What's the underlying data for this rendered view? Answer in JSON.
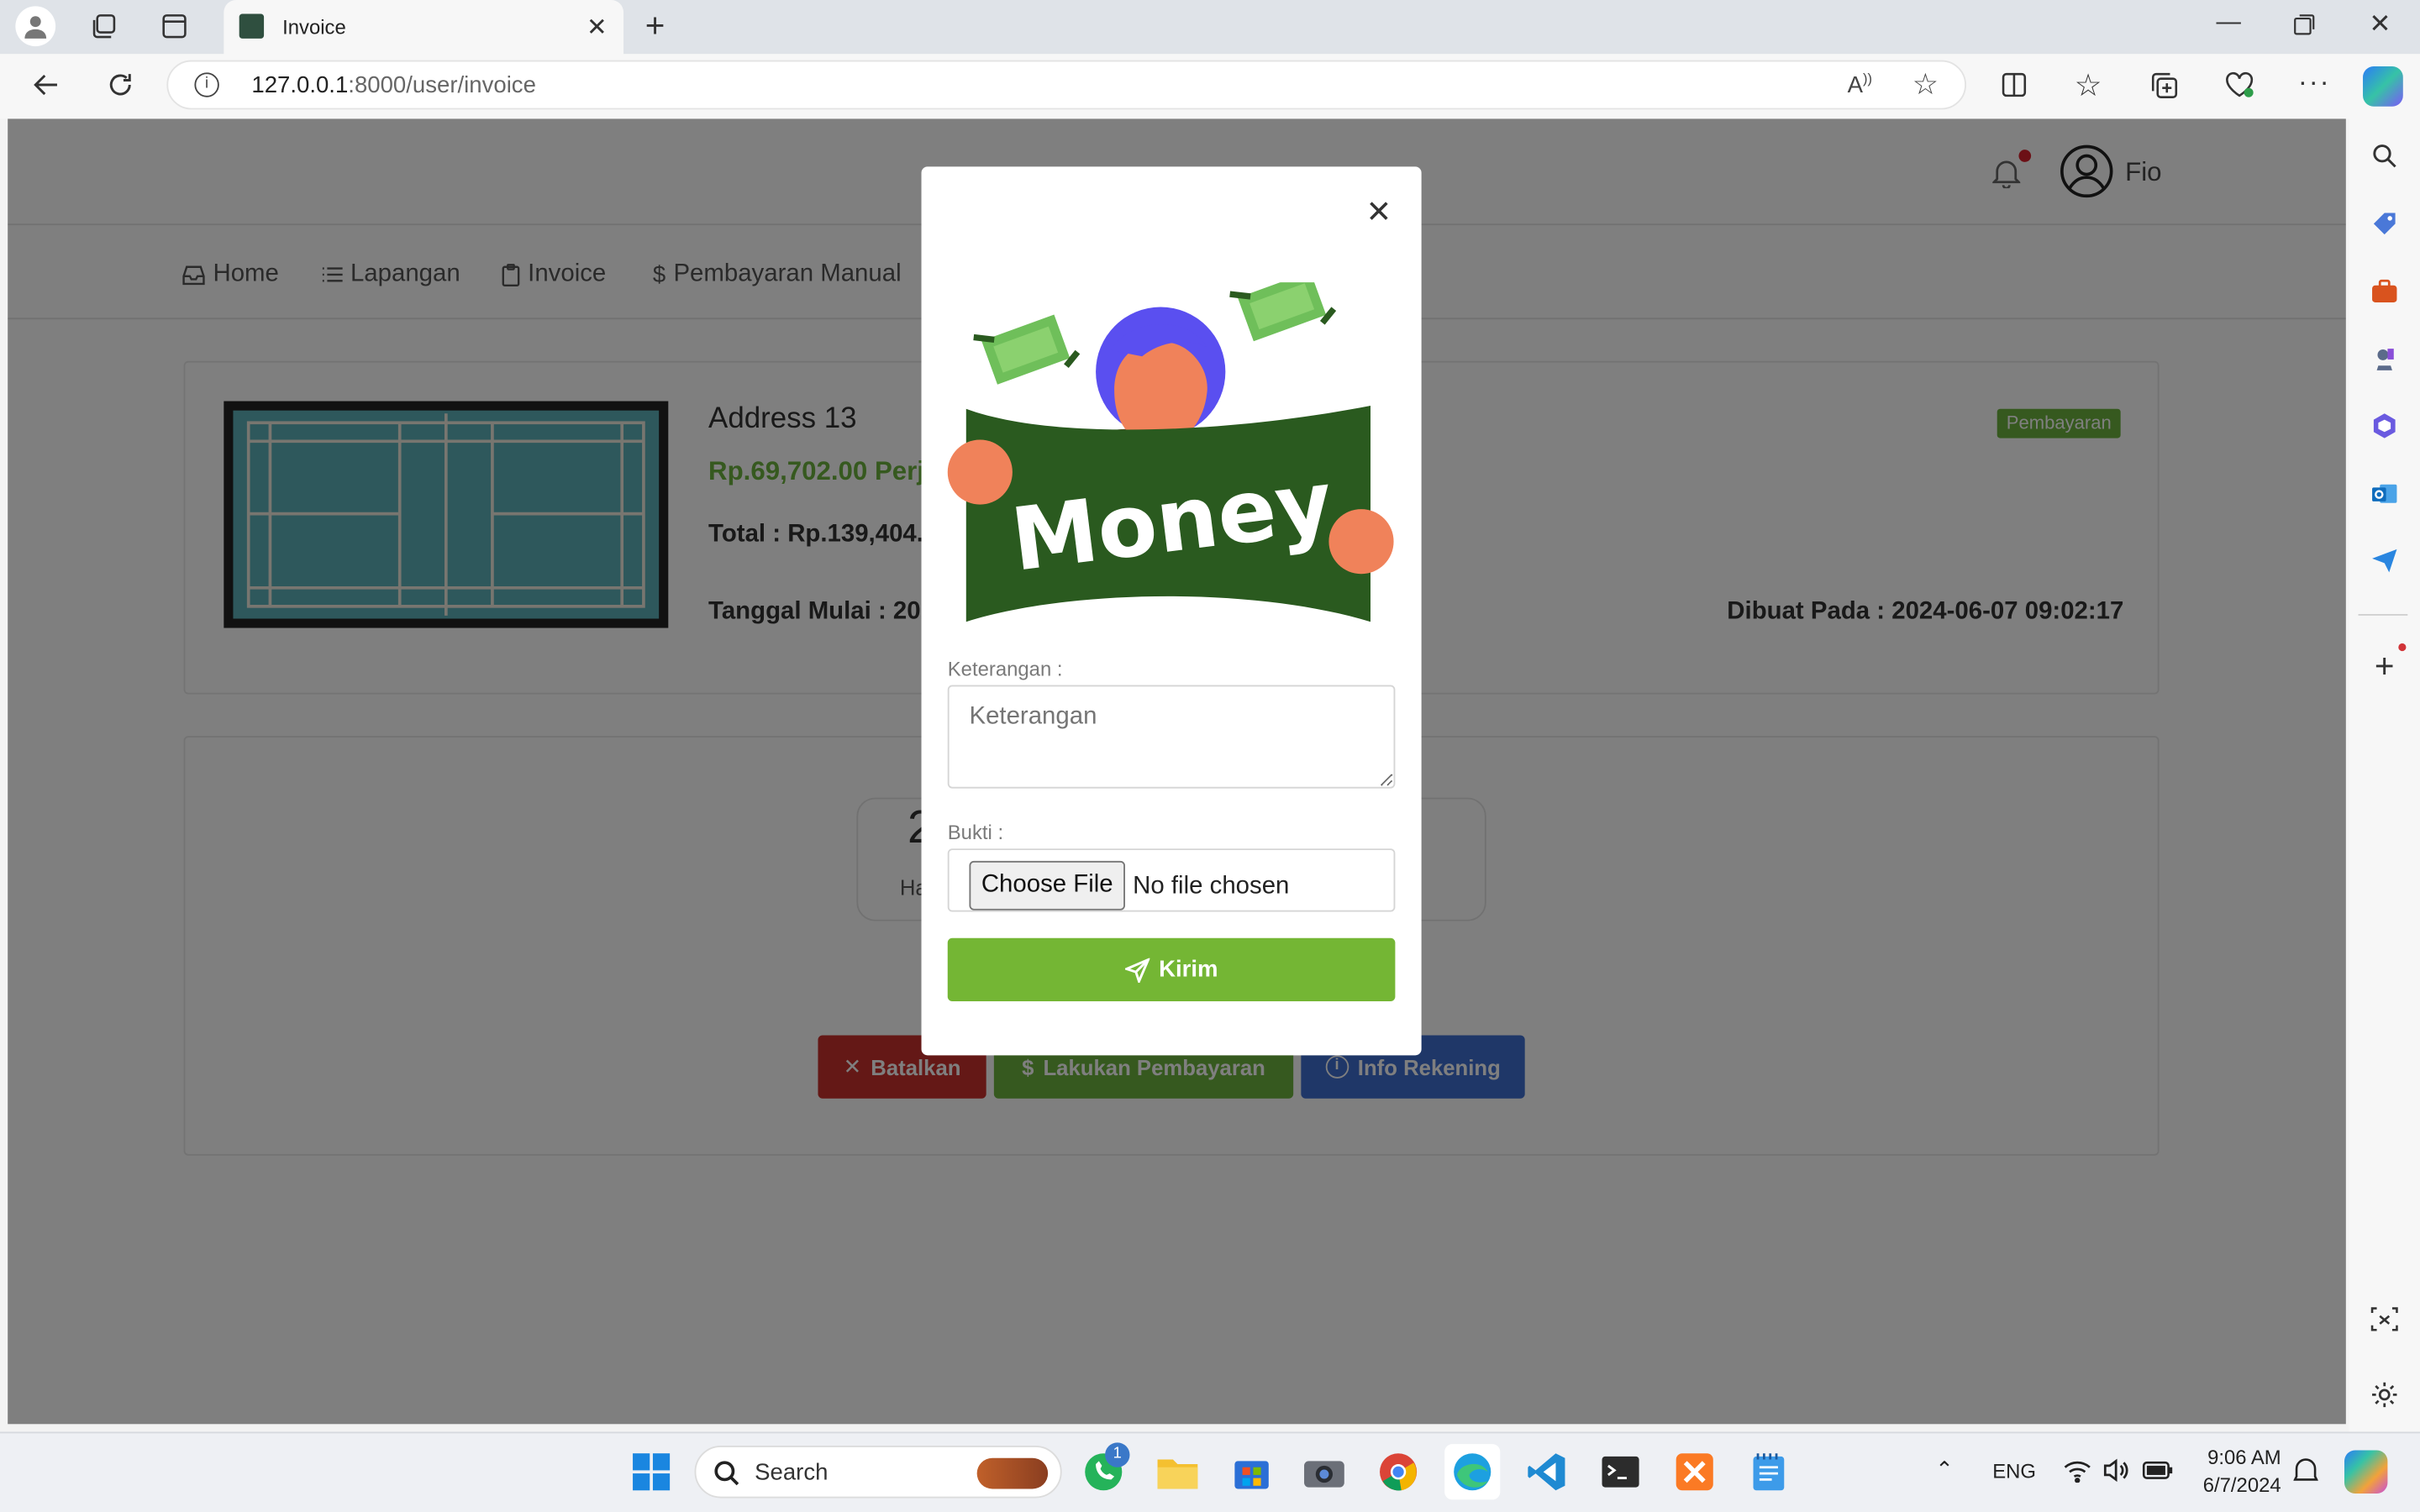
{
  "browser": {
    "tab_title": "Invoice",
    "url_host": "127.0.0.1",
    "url_rest": ":8000/user/invoice"
  },
  "header": {
    "user_name": "Fio"
  },
  "nav": {
    "items": [
      {
        "label": "Home",
        "icon": "inbox-icon"
      },
      {
        "label": "Lapangan",
        "icon": "list-icon"
      },
      {
        "label": "Invoice",
        "icon": "clipboard-icon"
      },
      {
        "label": "Pembayaran Manual",
        "icon": "dollar-icon"
      }
    ]
  },
  "invoice": {
    "title": "Address 13",
    "price": "Rp.69,702.00 Perj",
    "total": "Total : Rp.139,404.0",
    "start_date": "Tanggal Mulai : 202",
    "status_badge": "Pembayaran",
    "created_at": "Dibuat Pada : 2024-06-07 09:02:17"
  },
  "countdown": {
    "number_partial": "2",
    "label_partial": "Ha"
  },
  "actions": {
    "cancel": "Batalkan",
    "pay": "Lakukan Pembayaran",
    "info": "Info Rekening"
  },
  "modal": {
    "illustration_text": "Money",
    "keterangan_label": "Keterangan :",
    "keterangan_placeholder": "Keterangan",
    "bukti_label": "Bukti :",
    "file_button": "Choose File",
    "file_status": "No file chosen",
    "submit": "Kirim"
  },
  "taskbar": {
    "search_placeholder": "Search",
    "whatsapp_badge": "1",
    "language": "ENG",
    "time": "9:06 AM",
    "date": "6/7/2024"
  },
  "colors": {
    "green": "#6cb33f",
    "red": "#c9302c",
    "blue": "#3e6fd0",
    "money_green": "#2a5a1f"
  }
}
